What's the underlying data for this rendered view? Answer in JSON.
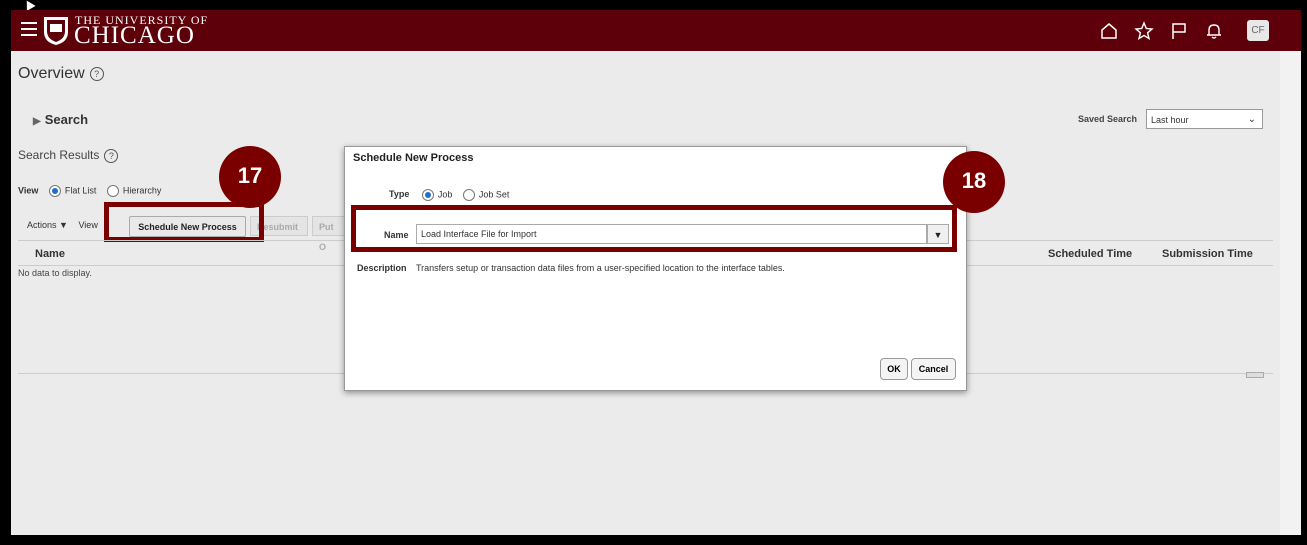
{
  "header": {
    "logo_small": "THE UNIVERSITY OF",
    "logo_big": "CHICAGO",
    "avatar_initials": "CF"
  },
  "page": {
    "title": "Overview",
    "search_label": "Search",
    "saved_search_label": "Saved Search",
    "saved_search_value": "Last hour",
    "results_title": "Search Results",
    "view_label": "View",
    "view_options": [
      "Flat List",
      "Hierarchy"
    ],
    "actions_label": "Actions",
    "view_menu_label": "View",
    "schedule_button": "Schedule New Process",
    "resubmit_button": "Resubmit",
    "put_on_hold_button": "Put O",
    "columns": [
      "Name",
      "Scheduled Time",
      "Submission Time"
    ],
    "no_data": "No data to display."
  },
  "modal": {
    "title": "Schedule New Process",
    "type_label": "Type",
    "type_options": [
      "Job",
      "Job Set"
    ],
    "name_label": "Name",
    "name_value": "Load Interface File for Import",
    "description_label": "Description",
    "description_text": "Transfers setup or transaction data files from a user-specified location to the interface tables.",
    "ok_label": "OK",
    "cancel_label": "Cancel"
  },
  "callouts": {
    "step_17": "17",
    "step_18": "18"
  },
  "colors": {
    "brand": "#5e0009",
    "callout": "#7a0000",
    "radio_selected": "#1f6fd1"
  }
}
